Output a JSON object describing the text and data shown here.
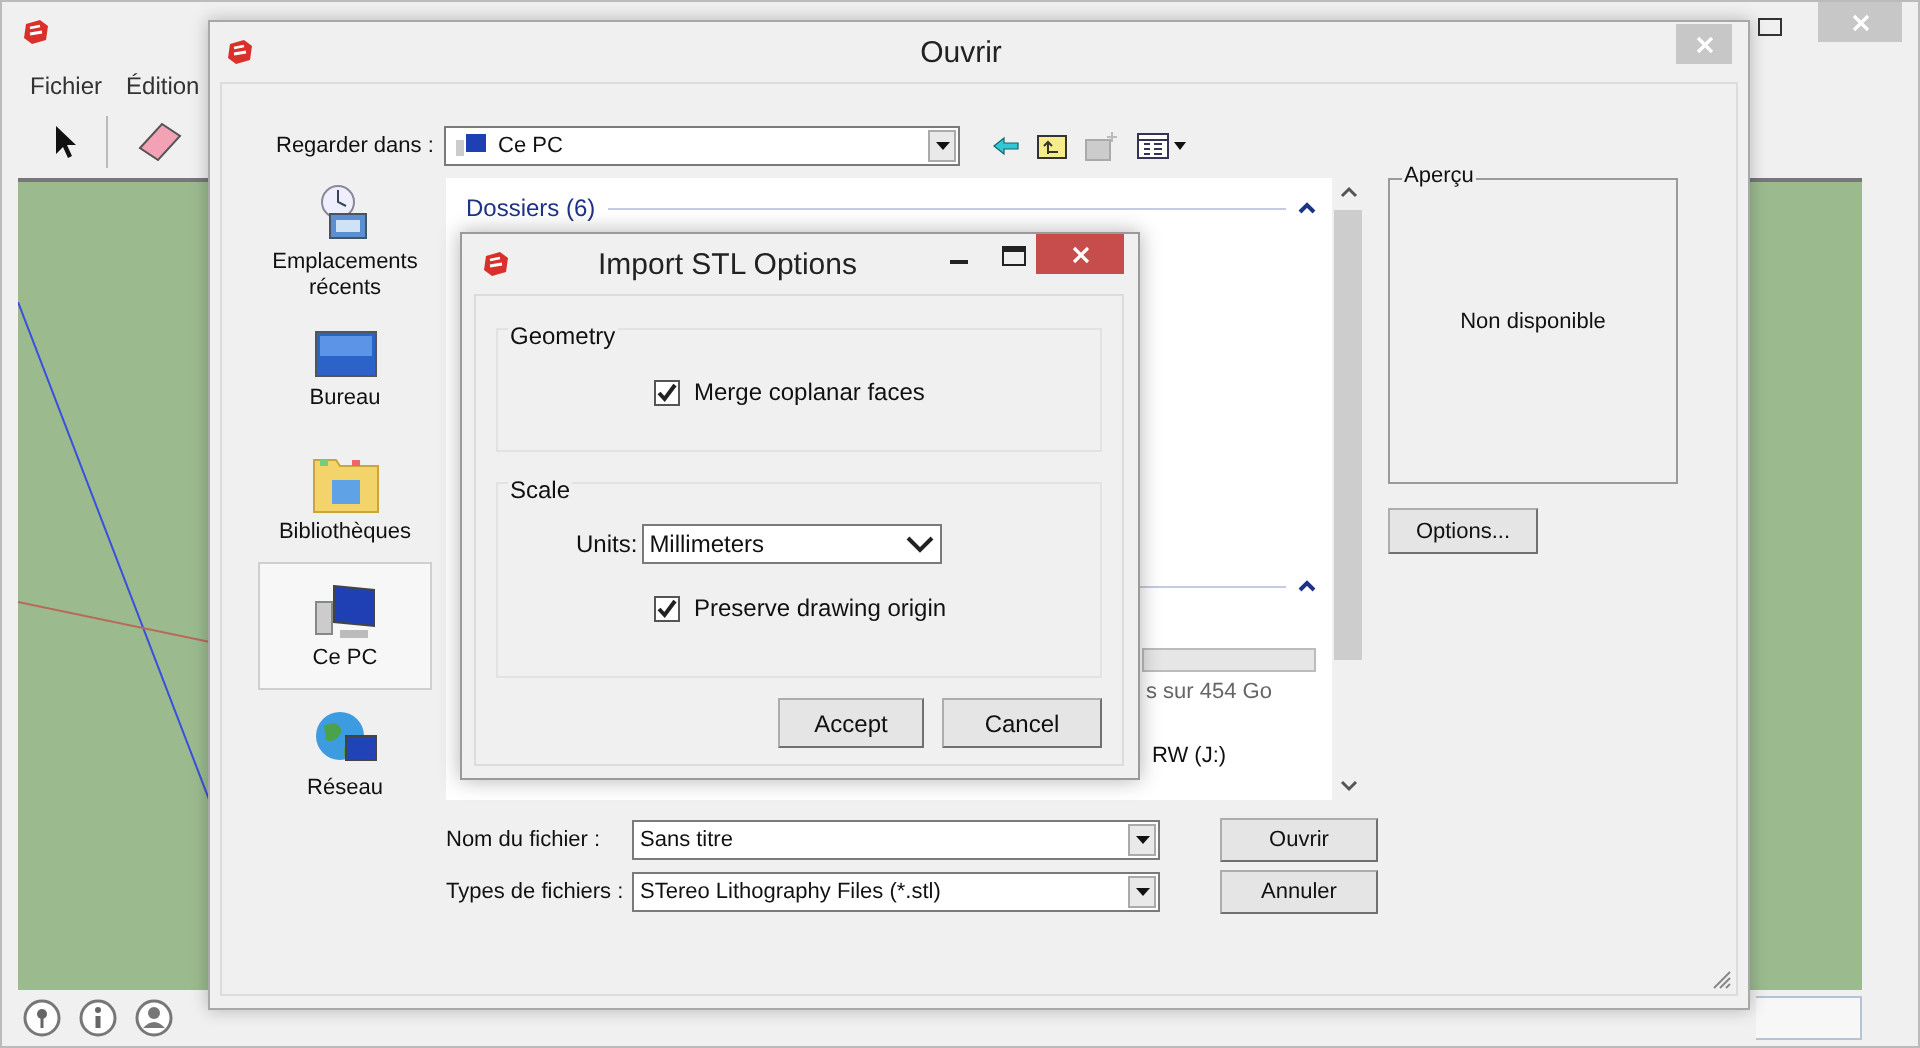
{
  "app": {
    "menu": [
      "Fichier",
      "Édition"
    ]
  },
  "open_dialog": {
    "title": "Ouvrir",
    "look_in": {
      "label": "Regarder dans :",
      "value": "Ce PC"
    },
    "places": [
      {
        "kind": "recent",
        "label": "Emplacements récents",
        "selected": false
      },
      {
        "kind": "desktop",
        "label": "Bureau",
        "selected": false
      },
      {
        "kind": "libraries",
        "label": "Bibliothèques",
        "selected": false
      },
      {
        "kind": "computer",
        "label": "Ce PC",
        "selected": true
      },
      {
        "kind": "network",
        "label": "Réseau",
        "selected": false
      }
    ],
    "group_title": "Dossiers (6)",
    "drive_texts": [
      "s sur 454 Go",
      "RW (J:)"
    ],
    "preview": {
      "title": "Aperçu",
      "text": "Non disponible"
    },
    "options_button": "Options...",
    "file_name": {
      "label": "Nom du fichier :",
      "value": "Sans titre"
    },
    "file_type": {
      "label": "Types de fichiers :",
      "value": "STereo Lithography Files (*.stl)"
    },
    "buttons": [
      "Ouvrir",
      "Annuler"
    ]
  },
  "stl_dialog": {
    "title": "Import STL Options",
    "geometry": {
      "title": "Geometry",
      "merge": {
        "label": "Merge coplanar faces",
        "checked": true
      }
    },
    "scale": {
      "title": "Scale",
      "units": {
        "label": "Units:",
        "value": "Millimeters"
      },
      "preserve": {
        "label": "Preserve drawing origin",
        "checked": true
      }
    },
    "buttons": [
      "Accept",
      "Cancel"
    ]
  }
}
